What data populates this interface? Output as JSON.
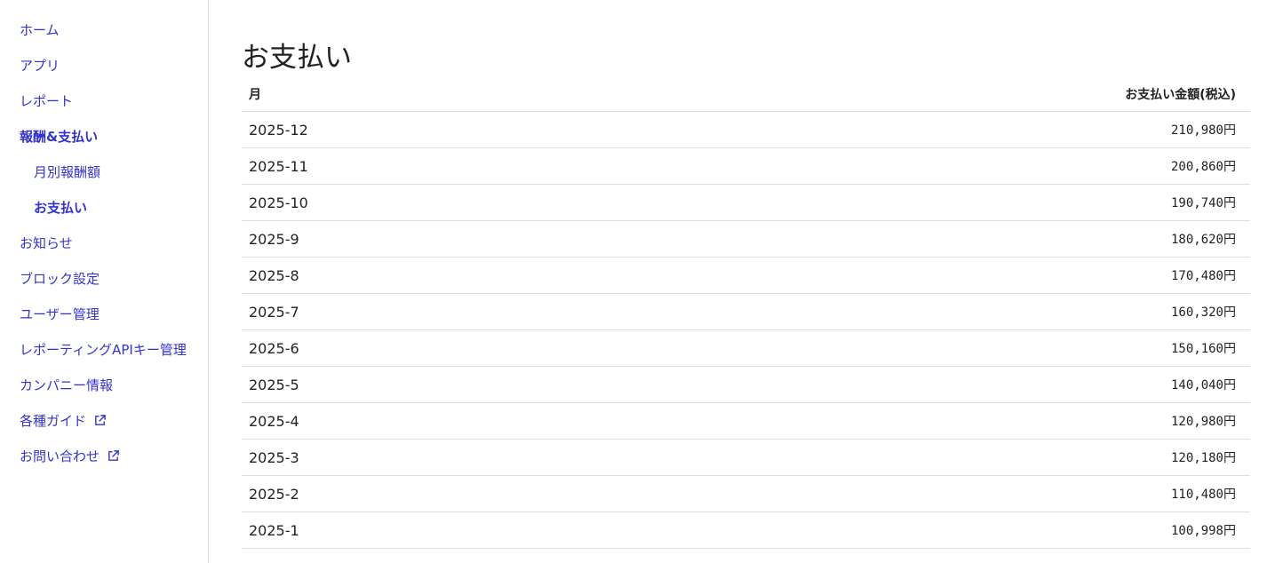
{
  "sidebar": {
    "items": [
      {
        "label": "ホーム"
      },
      {
        "label": "アプリ"
      },
      {
        "label": "レポート"
      },
      {
        "label": "報酬&支払い"
      },
      {
        "label": "月別報酬額"
      },
      {
        "label": "お支払い"
      },
      {
        "label": "お知らせ"
      },
      {
        "label": "ブロック設定"
      },
      {
        "label": "ユーザー管理"
      },
      {
        "label": "レポーティングAPIキー管理"
      },
      {
        "label": "カンパニー情報"
      },
      {
        "label": "各種ガイド"
      },
      {
        "label": "お問い合わせ"
      }
    ]
  },
  "page": {
    "title": "お支払い"
  },
  "table": {
    "headers": {
      "month": "月",
      "amount": "お支払い金額(税込)"
    },
    "rows": [
      {
        "month": "2025-12",
        "amount": "210,980円"
      },
      {
        "month": "2025-11",
        "amount": "200,860円"
      },
      {
        "month": "2025-10",
        "amount": "190,740円"
      },
      {
        "month": "2025-9",
        "amount": "180,620円"
      },
      {
        "month": "2025-8",
        "amount": "170,480円"
      },
      {
        "month": "2025-7",
        "amount": "160,320円"
      },
      {
        "month": "2025-6",
        "amount": "150,160円"
      },
      {
        "month": "2025-5",
        "amount": "140,040円"
      },
      {
        "month": "2025-4",
        "amount": "120,980円"
      },
      {
        "month": "2025-3",
        "amount": "120,180円"
      },
      {
        "month": "2025-2",
        "amount": "110,480円"
      },
      {
        "month": "2025-1",
        "amount": "100,998円"
      }
    ]
  },
  "colors": {
    "link": "#3333cc",
    "border": "#dddddd"
  }
}
